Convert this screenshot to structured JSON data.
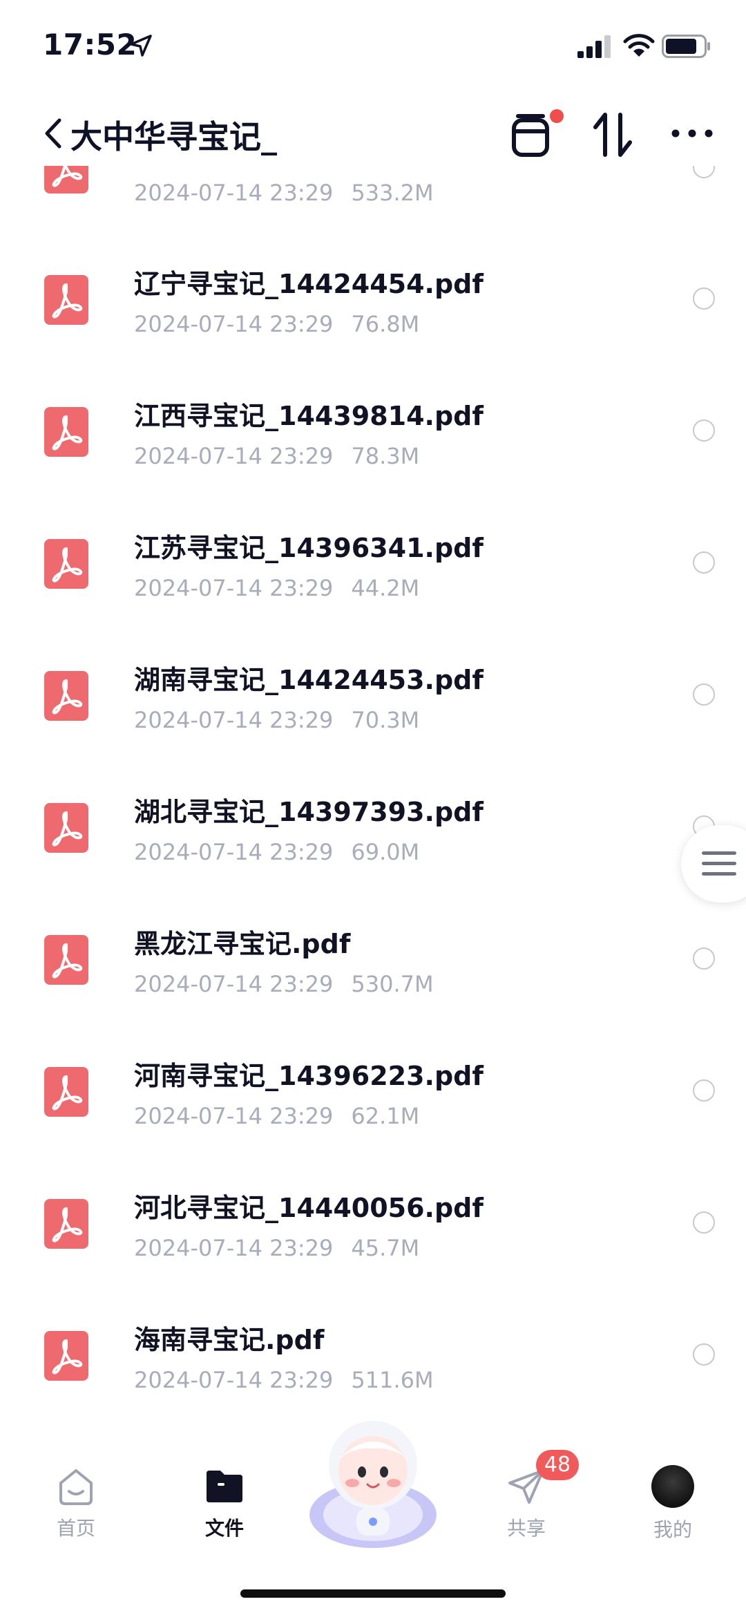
{
  "status_bar": {
    "time": "17:52"
  },
  "header": {
    "title": "大中华寻宝记_"
  },
  "files": [
    {
      "name": "",
      "date": "2024-07-14 23:29",
      "size": "533.2M"
    },
    {
      "name": "辽宁寻宝记_14424454.pdf",
      "date": "2024-07-14 23:29",
      "size": "76.8M"
    },
    {
      "name": "江西寻宝记_14439814.pdf",
      "date": "2024-07-14 23:29",
      "size": "78.3M"
    },
    {
      "name": "江苏寻宝记_14396341.pdf",
      "date": "2024-07-14 23:29",
      "size": "44.2M"
    },
    {
      "name": "湖南寻宝记_14424453.pdf",
      "date": "2024-07-14 23:29",
      "size": "70.3M"
    },
    {
      "name": "湖北寻宝记_14397393.pdf",
      "date": "2024-07-14 23:29",
      "size": "69.0M"
    },
    {
      "name": "黑龙江寻宝记.pdf",
      "date": "2024-07-14 23:29",
      "size": "530.7M"
    },
    {
      "name": "河南寻宝记_14396223.pdf",
      "date": "2024-07-14 23:29",
      "size": "62.1M"
    },
    {
      "name": "河北寻宝记_14440056.pdf",
      "date": "2024-07-14 23:29",
      "size": "45.7M"
    },
    {
      "name": "海南寻宝记.pdf",
      "date": "2024-07-14 23:29",
      "size": "511.6M"
    }
  ],
  "tabs": [
    {
      "label": "首页",
      "icon": "home-icon"
    },
    {
      "label": "文件",
      "icon": "folder-icon"
    },
    {
      "label": "",
      "icon": "mascot-icon"
    },
    {
      "label": "共享",
      "icon": "share-icon",
      "badge": "48"
    },
    {
      "label": "我的",
      "icon": "avatar"
    }
  ],
  "colors": {
    "pdf_red": "#ee6a6e",
    "accent_badge": "#f05a5a",
    "text_primary": "#111325",
    "text_secondary": "#a8acbb"
  }
}
